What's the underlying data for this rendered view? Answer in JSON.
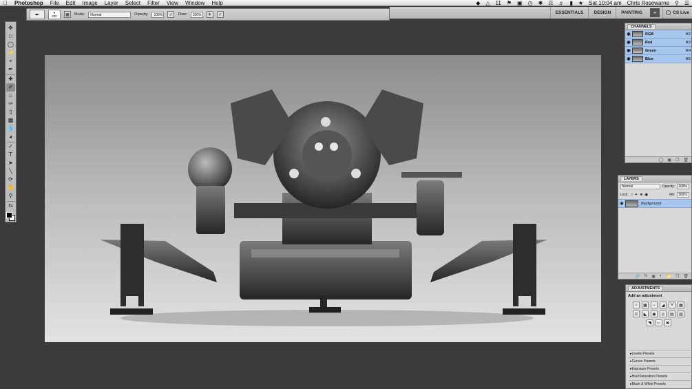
{
  "menubar": {
    "app_name": "Photoshop",
    "menus": [
      "File",
      "Edit",
      "Image",
      "Layer",
      "Select",
      "Filter",
      "View",
      "Window",
      "Help"
    ],
    "status_number": "11",
    "clock": "Sat 10:04 am",
    "user": "Chris Rosewarne"
  },
  "workspace": {
    "items": [
      "ESSENTIALS",
      "DESIGN",
      "PAINTING"
    ],
    "more_label": "»",
    "cs_live": "CS Live"
  },
  "options": {
    "brush_size": "600",
    "mode_label": "Mode:",
    "mode_value": "Normal",
    "opacity_label": "Opacity:",
    "opacity_value": "100%",
    "flow_label": "Flow:",
    "flow_value": "100%"
  },
  "channels": {
    "tab": "CHANNELS",
    "rows": [
      {
        "name": "RGB",
        "shortcut": "⌘2"
      },
      {
        "name": "Red",
        "shortcut": "⌘3"
      },
      {
        "name": "Green",
        "shortcut": "⌘4"
      },
      {
        "name": "Blue",
        "shortcut": "⌘5"
      }
    ]
  },
  "layers": {
    "tab": "LAYERS",
    "blend_mode": "Normal",
    "opacity_label": "Opacity:",
    "opacity_value": "100%",
    "lock_label": "Lock:",
    "fill_label": "Fill:",
    "fill_value": "100%",
    "layer_name": "Background"
  },
  "adjustments": {
    "tab": "ADJUSTMENTS",
    "header": "Add an adjustment",
    "presets": [
      "Levels Presets",
      "Curves Presets",
      "Exposure Presets",
      "Hue/Saturation Presets",
      "Black & White Presets"
    ]
  },
  "colors": {
    "selection_blue": "#a7c6ed",
    "foreground": "#000000",
    "background": "#ffffff"
  }
}
